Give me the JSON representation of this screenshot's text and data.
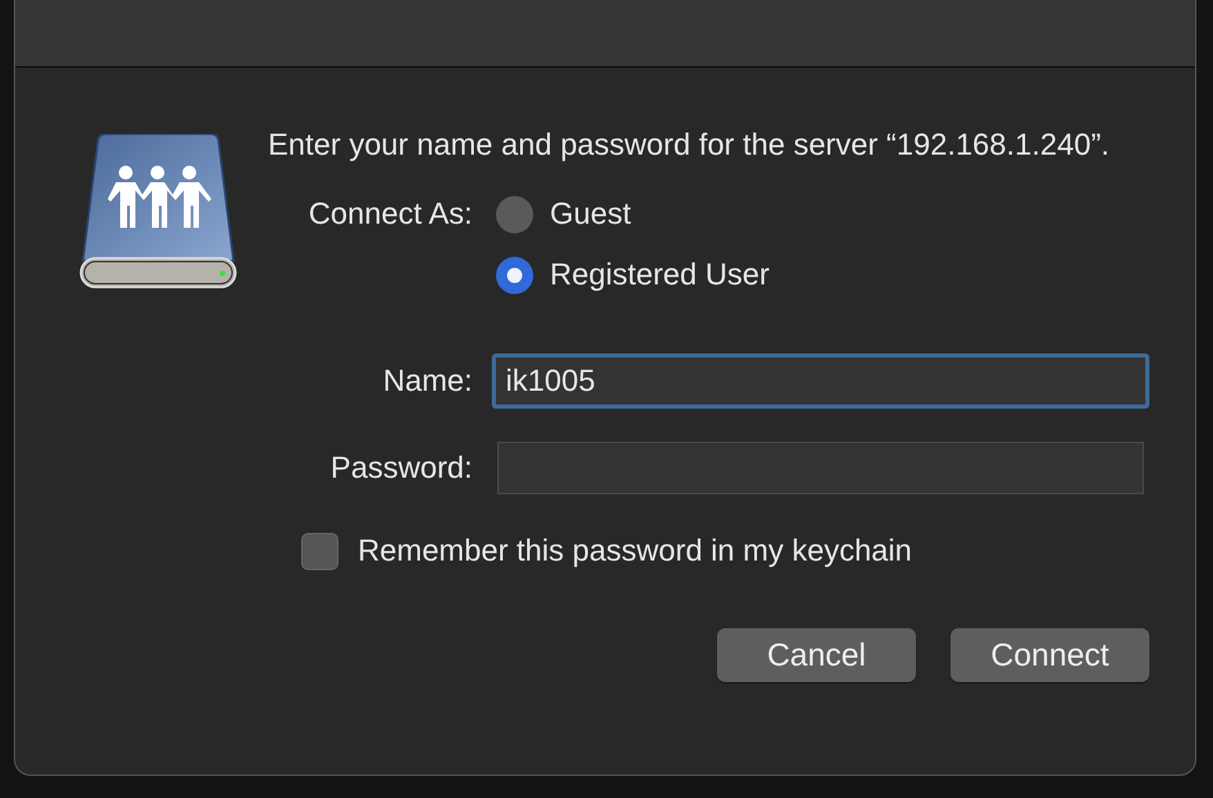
{
  "message": "Enter your name and password for the server “192.168.1.240”.",
  "connect_as": {
    "label": "Connect As:",
    "options": [
      {
        "label": "Guest",
        "selected": false
      },
      {
        "label": "Registered User",
        "selected": true
      }
    ]
  },
  "fields": [
    {
      "label": "Name:",
      "value": "ik1005",
      "focused": true
    },
    {
      "label": "Password:",
      "focused": false
    }
  ],
  "remember": {
    "label": "Remember this password in my keychain",
    "checked": false
  },
  "buttons": [
    "Cancel",
    "Connect"
  ]
}
